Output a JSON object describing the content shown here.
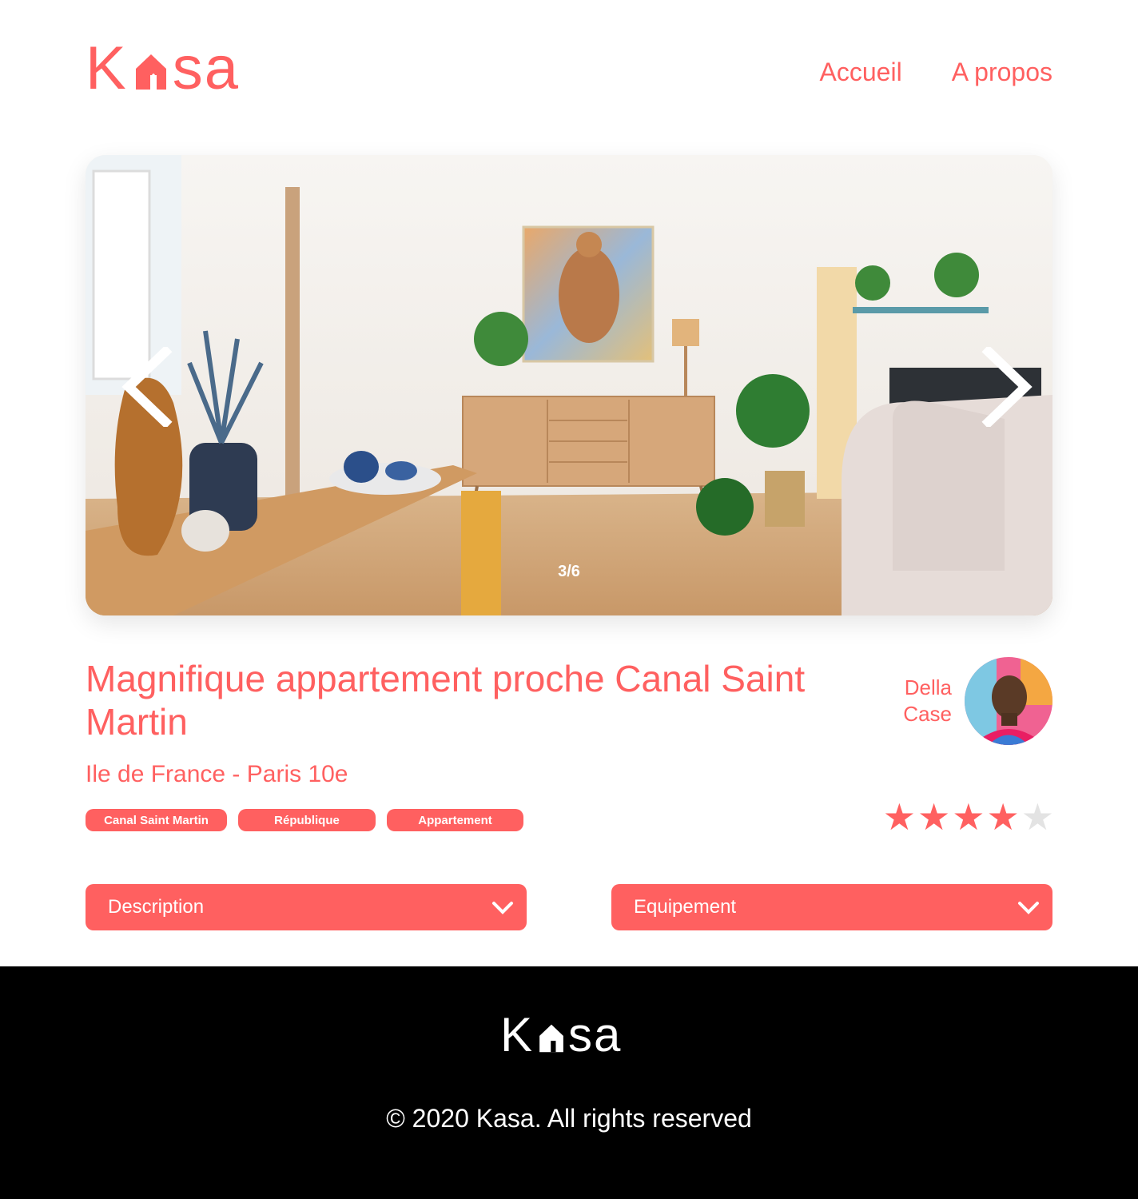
{
  "header": {
    "logo_left": "K",
    "logo_right": "sa",
    "nav": [
      {
        "label": "Accueil"
      },
      {
        "label": "A propos"
      }
    ]
  },
  "carousel": {
    "counter": "3/6",
    "prev_icon": "chevron-left-icon",
    "next_icon": "chevron-right-icon"
  },
  "listing": {
    "title": "Magnifique appartement proche Canal Saint Martin",
    "location": "Ile de France - Paris 10e",
    "tags": [
      "Canal Saint Martin",
      "République",
      "Appartement"
    ],
    "host": {
      "first_name": "Della",
      "last_name": "Case"
    },
    "rating": 4,
    "rating_max": 5
  },
  "collapses": [
    {
      "label": "Description",
      "icon": "chevron-down-icon"
    },
    {
      "label": "Equipement",
      "icon": "chevron-down-icon"
    }
  ],
  "footer": {
    "logo_left": "K",
    "logo_right": "sa",
    "copyright": "© 2020 Kasa. All rights reserved"
  },
  "colors": {
    "accent": "#FF6060",
    "footer_bg": "#000000",
    "star_off": "#E3E3E3"
  }
}
